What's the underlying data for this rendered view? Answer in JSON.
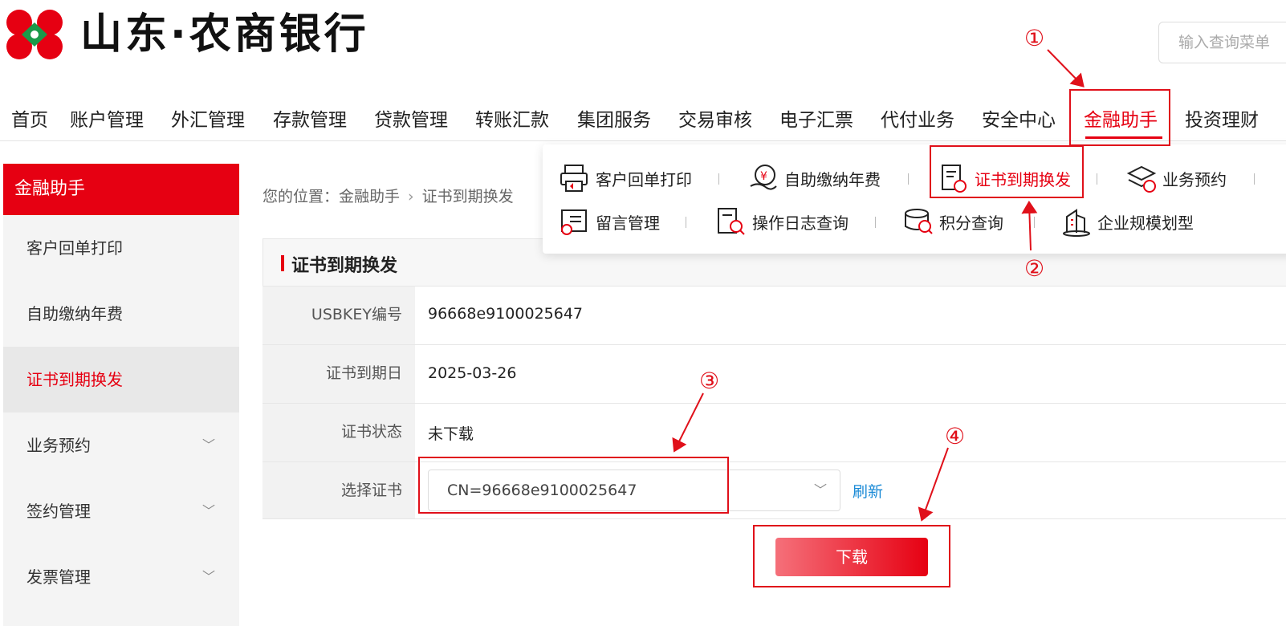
{
  "brand": {
    "name": "山东·农商银行"
  },
  "search": {
    "placeholder": "输入查询菜单"
  },
  "nav": {
    "items": [
      "首页",
      "账户管理",
      "外汇管理",
      "存款管理",
      "贷款管理",
      "转账汇款",
      "集团服务",
      "交易审核",
      "电子汇票",
      "代付业务",
      "安全中心",
      "金融助手",
      "投资理财"
    ],
    "active": "金融助手"
  },
  "dropdown": {
    "row1": [
      "客户回单打印",
      "自助缴纳年费",
      "证书到期换发",
      "业务预约"
    ],
    "row2": [
      "留言管理",
      "操作日志查询",
      "积分查询",
      "企业规模划型"
    ],
    "active": "证书到期换发"
  },
  "sidebar": {
    "title": "金融助手",
    "items": [
      {
        "label": "客户回单打印",
        "expandable": false
      },
      {
        "label": "自助缴纳年费",
        "expandable": false
      },
      {
        "label": "证书到期换发",
        "expandable": false,
        "active": true
      },
      {
        "label": "业务预约",
        "expandable": true
      },
      {
        "label": "签约管理",
        "expandable": true
      },
      {
        "label": "发票管理",
        "expandable": true
      }
    ]
  },
  "breadcrumb": {
    "prefix": "您的位置：",
    "items": [
      "金融助手",
      "证书到期换发"
    ],
    "separator": "›"
  },
  "form": {
    "title": "证书到期换发",
    "rows": [
      {
        "label": "USBKEY编号",
        "value": "96668e9100025647"
      },
      {
        "label": "证书到期日",
        "value": "2025-03-26"
      },
      {
        "label": "证书状态",
        "value": "未下载"
      },
      {
        "label": "选择证书",
        "value": "CN=96668e9100025647"
      }
    ],
    "refresh_label": "刷新",
    "download_label": "下载"
  },
  "annotations": [
    "①",
    "②",
    "③",
    "④"
  ],
  "colors": {
    "brand_red": "#e60012",
    "link_blue": "#1a8ad6",
    "annotation_red": "#e0101a"
  }
}
